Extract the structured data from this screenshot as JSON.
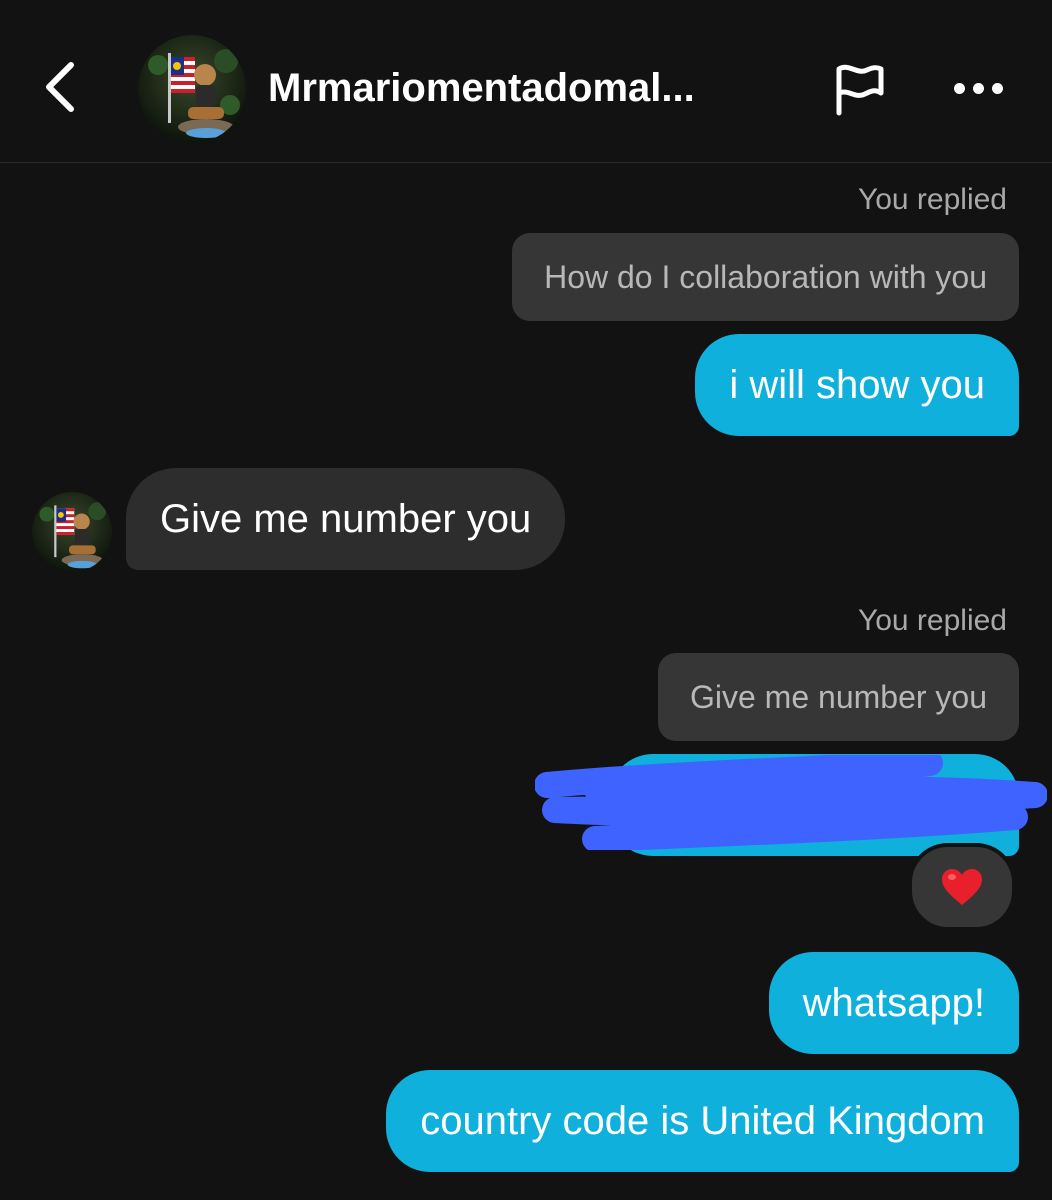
{
  "header": {
    "contact_name": "Mrmariomentadomal...",
    "back_icon": "chevron-left-icon",
    "flag_icon": "flag-icon",
    "more_icon": "more-horizontal-icon"
  },
  "messages": [
    {
      "type": "outgoing_reply",
      "reply_label": "You replied",
      "quoted_text": "How do I collaboration with you",
      "text": "i will show you"
    },
    {
      "type": "incoming",
      "text": "Give me number you"
    },
    {
      "type": "outgoing_reply",
      "reply_label": "You replied",
      "quoted_text": "Give me number you",
      "text": "",
      "redacted": true,
      "reaction": "❤️"
    },
    {
      "type": "outgoing",
      "text": "whatsapp!"
    },
    {
      "type": "outgoing",
      "text": "country code is United Kingdom"
    }
  ],
  "colors": {
    "background": "#121212",
    "outgoing_bubble": "#0fb0dc",
    "incoming_bubble": "#2d2d2d",
    "quote_bubble": "#363636",
    "redaction_scribble": "#3f63ff"
  }
}
